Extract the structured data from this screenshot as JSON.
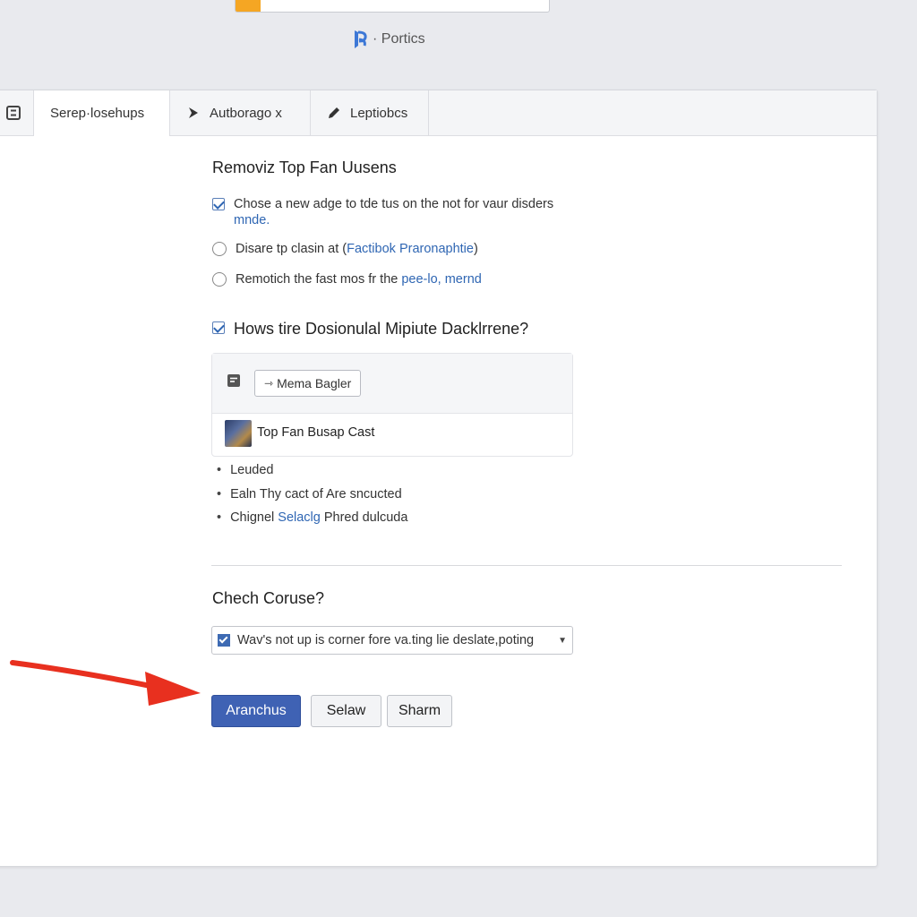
{
  "brand": {
    "text": "· Portics",
    "logo_color": "#3d78d6"
  },
  "tabs": [
    {
      "label": "",
      "icon": "menu-icon"
    },
    {
      "label": "Serep·losehups",
      "icon": ""
    },
    {
      "label": "Autborago x",
      "icon": "arrow-right-icon"
    },
    {
      "label": "Leptiobcs",
      "icon": "pencil-icon"
    }
  ],
  "section1": {
    "title": "Removiz Top Fan Uusens",
    "options": [
      {
        "text": "Chose a new adge to tde tus on the not for vaur disders",
        "link": "mnde.",
        "checked": true
      },
      {
        "text": "Disare tp clasin at (",
        "link": "Factibok Praronaphtie",
        "suffix": ")",
        "selected": false
      },
      {
        "text": "Remotich the fast mos fr the ",
        "link": "pee-lo, mernd",
        "selected": false
      }
    ]
  },
  "section2": {
    "title": "Hows tire Dosionulal Mipiute Dacklrrene?",
    "checked": true,
    "card": {
      "button_label": "Mema Bagler",
      "row_text": "Top Fan Busap Cast"
    },
    "bullets": [
      {
        "text": "Leuded",
        "link": ""
      },
      {
        "text": "Ealn Thy cact of Are sncucted",
        "link": ""
      },
      {
        "text": "Chignel",
        "link": "Selaclg",
        "suffix": " Phred dulcuda"
      }
    ]
  },
  "section3": {
    "title": "Chech Coruse?",
    "select_value": "Wav's not up is corner fore va.ting lie deslate,poting"
  },
  "actions": {
    "primary": "Aranchus",
    "secondary": "Selaw",
    "tertiary": "Sharm"
  },
  "colors": {
    "accent": "#3f62b4",
    "link": "#2f66b3",
    "annotation_arrow": "#e8301f",
    "search_accent": "#f5a623"
  }
}
